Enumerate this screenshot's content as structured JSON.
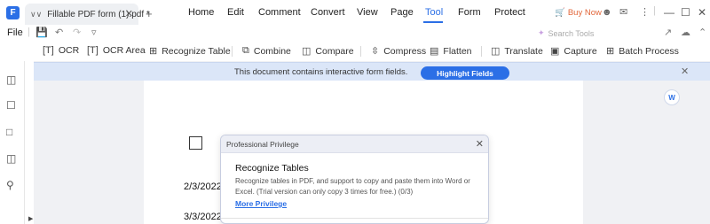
{
  "titlebar": {
    "tab_title": "Fillable PDF form (1).pdf *",
    "buy_now": "Buy Now",
    "menus": [
      "Home",
      "Edit",
      "Comment",
      "Convert",
      "View",
      "Page",
      "Tool",
      "Form",
      "Protect"
    ],
    "active_menu": "Tool"
  },
  "row2": {
    "file": "File",
    "search_placeholder": "Search Tools"
  },
  "toolbar": {
    "ocr": "OCR",
    "ocr_area": "OCR Area",
    "recognize_table": "Recognize Table",
    "combine": "Combine",
    "compare": "Compare",
    "compress": "Compress",
    "flatten": "Flatten",
    "translate": "Translate",
    "capture": "Capture",
    "batch_process": "Batch Process"
  },
  "notice": {
    "text": "This document contains interactive form fields.",
    "button": "Highlight Fields"
  },
  "document": {
    "dates": [
      "2/3/2022",
      "3/3/2022"
    ]
  },
  "popup": {
    "title": "Professional Privilege",
    "heading": "Recognize Tables",
    "description": "Recognize tables in PDF, and support to copy and paste them into Word or Excel. (Trial version can only copy 3 times for free.) (0/3)",
    "link": "More Privilege"
  },
  "colors": {
    "accent": "#2b6fe6",
    "buy_now": "#e2673b",
    "notice_bg": "#dbe6f8"
  }
}
